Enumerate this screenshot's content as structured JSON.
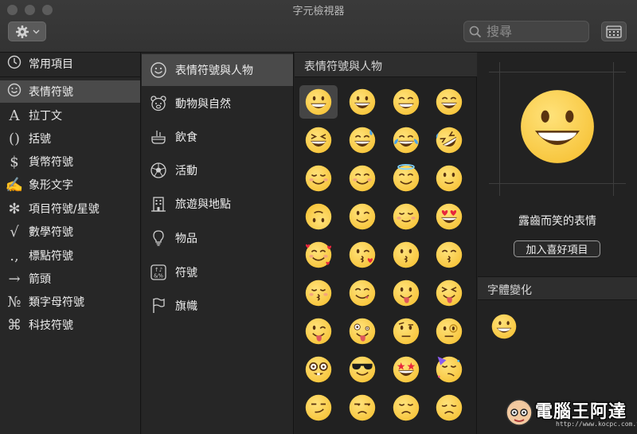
{
  "window": {
    "title": "字元檢視器"
  },
  "toolbar": {
    "search_placeholder": "搜尋"
  },
  "sidebar": {
    "items": [
      {
        "icon": "clock-icon",
        "glyph": "",
        "label": "常用項目"
      },
      {
        "icon": "smiley-icon",
        "glyph": "",
        "label": "表情符號"
      },
      {
        "icon": "latin-a-icon",
        "glyph": "A",
        "label": "拉丁文"
      },
      {
        "icon": "parentheses-icon",
        "glyph": "()",
        "label": "括號"
      },
      {
        "icon": "dollar-icon",
        "glyph": "$",
        "label": "貨幣符號"
      },
      {
        "icon": "pictograph-icon",
        "glyph": "✍",
        "label": "象形文字"
      },
      {
        "icon": "asterisk-icon",
        "glyph": "✻",
        "label": "項目符號/星號"
      },
      {
        "icon": "sqrt-icon",
        "glyph": "√",
        "label": "數學符號"
      },
      {
        "icon": "punctuation-icon",
        "glyph": ".,",
        "label": "標點符號"
      },
      {
        "icon": "arrow-icon",
        "glyph": "→",
        "label": "箭頭"
      },
      {
        "icon": "numero-icon",
        "glyph": "№",
        "label": "類字母符號"
      },
      {
        "icon": "command-icon",
        "glyph": "⌘",
        "label": "科技符號"
      }
    ],
    "selected_index": 1
  },
  "categories": {
    "items": [
      {
        "icon": "smiley-outline-icon",
        "label": "表情符號與人物"
      },
      {
        "icon": "bear-icon",
        "label": "動物與自然"
      },
      {
        "icon": "food-icon",
        "label": "飲食"
      },
      {
        "icon": "soccer-ball-icon",
        "label": "活動"
      },
      {
        "icon": "building-icon",
        "label": "旅遊與地點"
      },
      {
        "icon": "lightbulb-icon",
        "label": "物品"
      },
      {
        "icon": "symbols-icon",
        "label": "符號"
      },
      {
        "icon": "flag-icon",
        "label": "旗幟"
      }
    ],
    "selected_index": 0
  },
  "grid": {
    "header": "表情符號與人物",
    "emojis": [
      "grinning",
      "grin",
      "grin2",
      "grin3",
      "laugh-squint",
      "sweat-smile",
      "tears-joy",
      "rofl",
      "relaxed",
      "blush",
      "halo",
      "slight-smile",
      "upside-down",
      "wink",
      "relieved",
      "heart-eyes",
      "smiling-hearts",
      "kiss-heart",
      "kissing",
      "kissing-smiling",
      "kissing-closed",
      "yum",
      "tongue",
      "tongue-squint",
      "tongue-wink",
      "zany",
      "raised-brow",
      "monocle",
      "nerd",
      "sunglasses",
      "star-struck",
      "party",
      "smirk",
      "unamused",
      "disappointed",
      "pensive"
    ],
    "selected_index": 0
  },
  "detail": {
    "name": "露齒而笑的表情",
    "favorite_button": "加入喜好項目",
    "variants_header": "字體變化"
  },
  "colors": {
    "emoji_face": "#f7c43a",
    "emoji_feature": "#5a3410",
    "heart": "#e8263c",
    "tear": "#4aa3e8",
    "selection": "#4a4a4a"
  },
  "watermark": {
    "title": "電腦王阿達",
    "url": "http://www.kocpc.com.tw"
  }
}
